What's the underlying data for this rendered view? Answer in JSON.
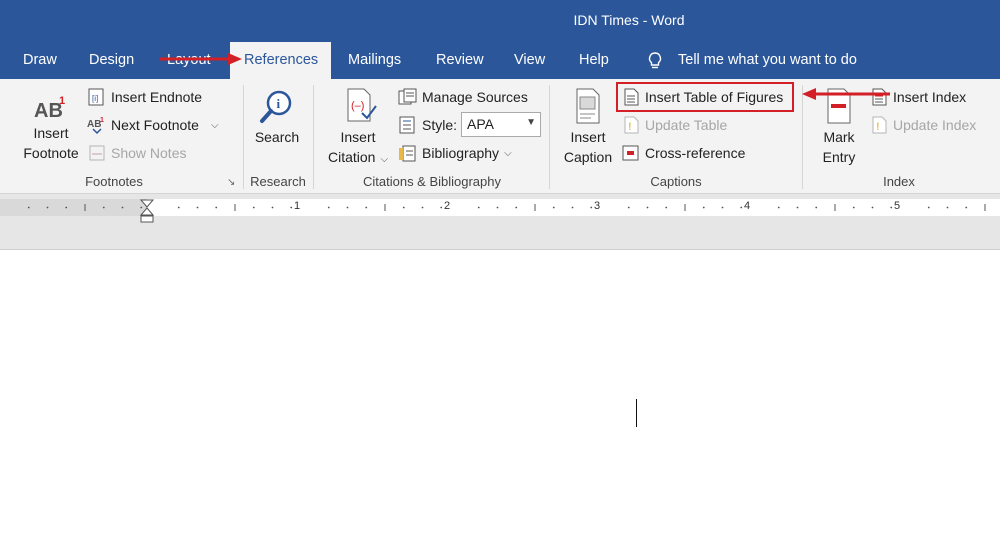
{
  "window": {
    "title": "IDN Times  -  Word"
  },
  "tabs": [
    {
      "label": "Draw"
    },
    {
      "label": "Design"
    },
    {
      "label": "Layout"
    },
    {
      "label": "References"
    },
    {
      "label": "Mailings"
    },
    {
      "label": "Review"
    },
    {
      "label": "View"
    },
    {
      "label": "Help"
    }
  ],
  "tell_me": {
    "placeholder": "Tell me what you want to do"
  },
  "ribbon": {
    "footnotes": {
      "label": "Footnotes",
      "insert_footnote": [
        "Insert",
        "Footnote"
      ],
      "insert_endnote": "Insert Endnote",
      "next_footnote": "Next Footnote",
      "show_notes": "Show Notes"
    },
    "research": {
      "label": "Research",
      "search": "Search"
    },
    "citations": {
      "label": "Citations & Bibliography",
      "insert_citation": [
        "Insert",
        "Citation"
      ],
      "manage_sources": "Manage Sources",
      "style_label": "Style:",
      "style_value": "APA",
      "bibliography": "Bibliography"
    },
    "captions": {
      "label": "Captions",
      "insert_caption": [
        "Insert",
        "Caption"
      ],
      "insert_table_of_figures": "Insert Table of Figures",
      "update_table": "Update Table",
      "cross_reference": "Cross-reference"
    },
    "index": {
      "label": "Index",
      "mark_entry": [
        "Mark",
        "Entry"
      ],
      "insert_index": "Insert Index",
      "update_index": "Update Index"
    }
  },
  "ruler": {
    "numbers": [
      "1",
      "2",
      "3",
      "4",
      "5"
    ]
  },
  "colors": {
    "brand": "#2b579a",
    "annotation": "#d31f26",
    "ribbon": "#f3f3f3"
  }
}
